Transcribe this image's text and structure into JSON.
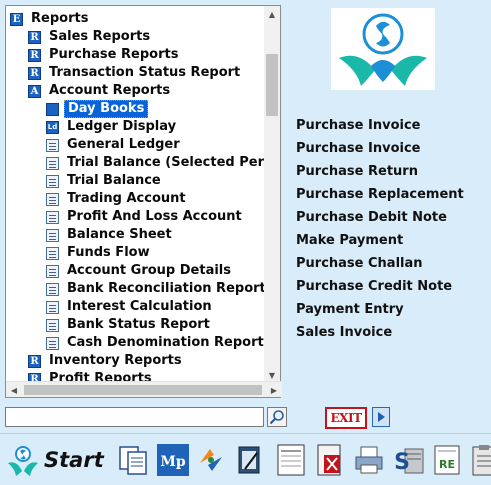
{
  "tree": {
    "items": [
      {
        "label": "Reports",
        "level": 0,
        "icon": "E",
        "icon_kind": "letter"
      },
      {
        "label": "Sales Reports",
        "level": 1,
        "icon": "R",
        "icon_kind": "letter"
      },
      {
        "label": "Purchase Reports",
        "level": 1,
        "icon": "R",
        "icon_kind": "letter"
      },
      {
        "label": "Transaction Status Report",
        "level": 1,
        "icon": "R",
        "icon_kind": "letter"
      },
      {
        "label": "Account Reports",
        "level": 1,
        "icon": "A",
        "icon_kind": "letter"
      },
      {
        "label": "Day Books",
        "level": 2,
        "icon": "",
        "icon_kind": "ld-gear",
        "selected": true
      },
      {
        "label": "Ledger Display",
        "level": 2,
        "icon": "Ld",
        "icon_kind": "ld"
      },
      {
        "label": "General Ledger",
        "level": 2,
        "icon": "",
        "icon_kind": "doc"
      },
      {
        "label": "Trial Balance (Selected Per",
        "level": 2,
        "icon": "",
        "icon_kind": "doc"
      },
      {
        "label": "Trial Balance",
        "level": 2,
        "icon": "",
        "icon_kind": "doc"
      },
      {
        "label": "Trading Account",
        "level": 2,
        "icon": "",
        "icon_kind": "doc"
      },
      {
        "label": "Profit And Loss Account",
        "level": 2,
        "icon": "",
        "icon_kind": "doc"
      },
      {
        "label": "Balance Sheet",
        "level": 2,
        "icon": "",
        "icon_kind": "doc"
      },
      {
        "label": "Funds Flow",
        "level": 2,
        "icon": "",
        "icon_kind": "doc"
      },
      {
        "label": "Account Group Details",
        "level": 2,
        "icon": "",
        "icon_kind": "doc"
      },
      {
        "label": "Bank Reconciliation Report",
        "level": 2,
        "icon": "",
        "icon_kind": "doc"
      },
      {
        "label": "Interest Calculation",
        "level": 2,
        "icon": "",
        "icon_kind": "doc"
      },
      {
        "label": "Bank Status Report",
        "level": 2,
        "icon": "",
        "icon_kind": "doc"
      },
      {
        "label": "Cash Denomination Report",
        "level": 2,
        "icon": "",
        "icon_kind": "doc"
      },
      {
        "label": "Inventory Reports",
        "level": 1,
        "icon": "R",
        "icon_kind": "letter"
      },
      {
        "label": "Profit Reports",
        "level": 1,
        "icon": "R",
        "icon_kind": "letter"
      }
    ]
  },
  "quick_links": [
    "Purchase Invoice",
    "Purchase Invoice",
    "Purchase Return",
    "Purchase Replacement",
    "Purchase Debit Note",
    "Make Payment",
    "Purchase Challan",
    "Purchase Credit Note",
    "Payment Entry",
    "Sales Invoice"
  ],
  "search": {
    "value": "",
    "icon": "magnifier-icon"
  },
  "exit_button": {
    "label": "EXIT"
  },
  "next_button": {
    "icon": "play-arrow-icon"
  },
  "taskbar": {
    "start_label": "Start",
    "icons": [
      "copy-icon",
      "mp-icon",
      "refresh-arrows-icon",
      "notepad-icon",
      "journal-icon",
      "remove-doc-icon",
      "printer-icon",
      "s-server-icon",
      "report-re-icon",
      "clipboard-icon"
    ]
  },
  "colors": {
    "background": "#d9ecf9",
    "selection": "#0a64d8",
    "exit_red": "#c4131a",
    "icon_blue": "#1a63c2"
  }
}
